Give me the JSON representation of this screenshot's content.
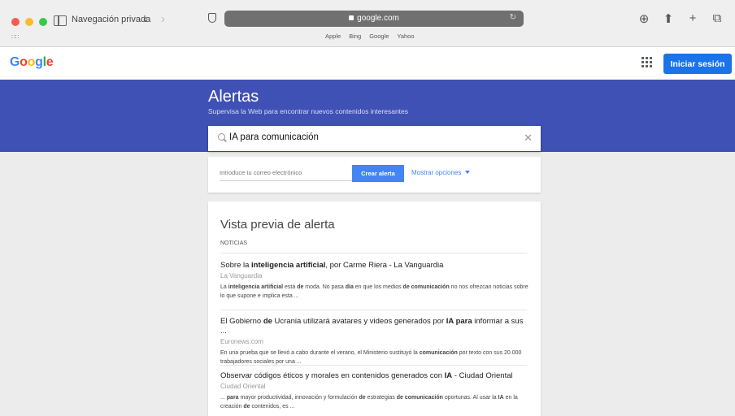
{
  "browser": {
    "window_label": "Navegación privada",
    "url": "google.com",
    "favorites": [
      "Apple",
      "Bing",
      "Google",
      "Yahoo"
    ]
  },
  "header": {
    "logo": "Google",
    "signin_label": "Iniciar sesión"
  },
  "page": {
    "title": "Alertas",
    "subtitle": "Supervisa la Web para encontrar nuevos contenidos interesantes"
  },
  "search": {
    "value": "IA para comunicación"
  },
  "options": {
    "email_placeholder": "Introduce tu correo electrónico",
    "create_label": "Crear alerta",
    "show_options_label": "Mostrar opciones"
  },
  "preview": {
    "title": "Vista previa de alerta",
    "section": "NOTICIAS",
    "items": [
      {
        "title_html": "Sobre la <b>inteligencia artificial</b>, por Carme Riera - La Vanguardia",
        "source": "La Vanguardia",
        "snippet_html": "La <b>inteligencia artificial</b> está <b>de</b> moda. No pasa <b>día</b> en que los medios <b>de comunicación</b> no nos ofrezcan noticias sobre lo que supone e implica esta ..."
      },
      {
        "title_html": "El Gobierno <b>de</b> Ucrania utilizará avatares y videos generados por <b>IA para</b> informar a sus ...",
        "source": "Euronews.com",
        "snippet_html": "En una prueba que se llevó a cabo durante el verano, el Ministerio sustituyó la <b>comunicación</b> por texto con sus 20.000 trabajadores sociales por una ..."
      },
      {
        "title_html": "Observar códigos éticos y morales en contenidos generados con <b>IA</b> - Ciudad Oriental",
        "source": "Ciudad Oriental",
        "snippet_html": "... <b>para</b> mayor productividad, innovación y formulación <b>de</b> estrategias <b>de comunicación</b> oportunas. Al usar la <b>IA</b> en la creación <b>de</b> contenidos, es ..."
      }
    ]
  },
  "colors": {
    "banner": "#4051b5",
    "primary_button": "#1a73e8",
    "google_blue": "#4285f4",
    "google_red": "#ea4335",
    "google_yellow": "#fbbc05",
    "google_green": "#34a853"
  }
}
